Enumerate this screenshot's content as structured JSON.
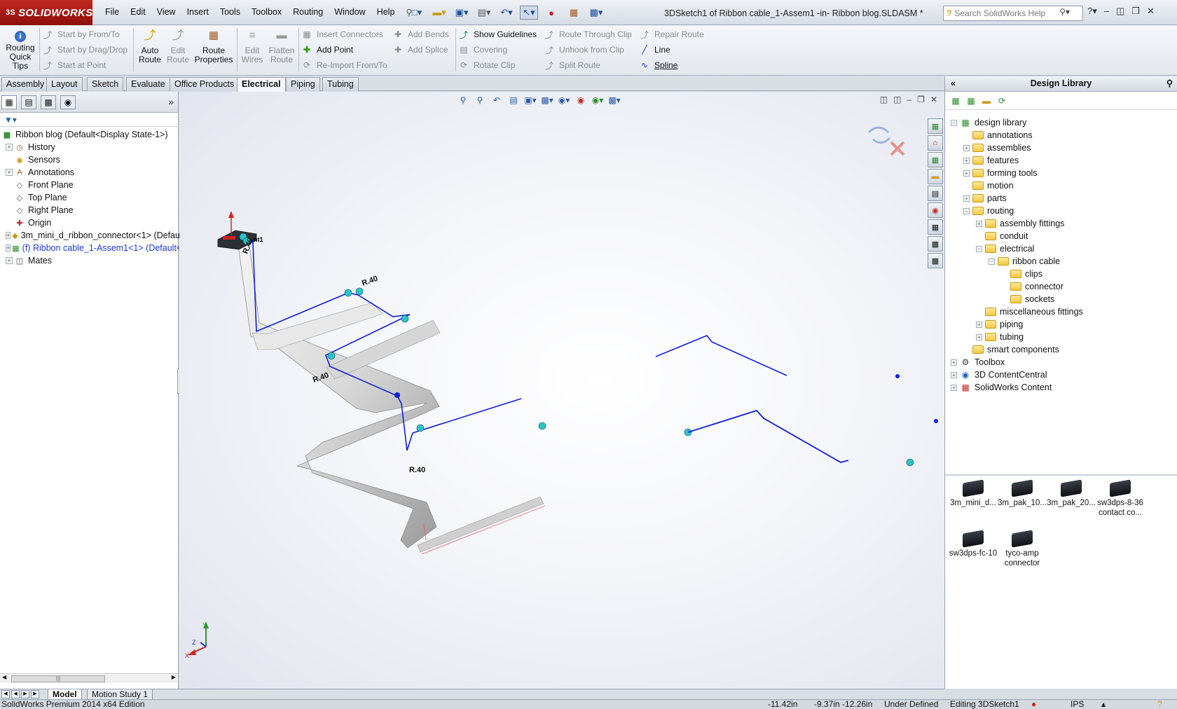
{
  "app": {
    "logo_text": "SOLIDWORKS",
    "logo_prefix": "3S",
    "window_title": "3DSketch1 of Ribbon cable_1-Assem1 -in- Ribbon blog.SLDASM *",
    "search_placeholder": "Search SolidWorks Help"
  },
  "menu": [
    "File",
    "Edit",
    "View",
    "Insert",
    "Tools",
    "Toolbox",
    "Routing",
    "Window",
    "Help"
  ],
  "ribbon": {
    "routing_quick_tips": "Routing Quick Tips",
    "start_from_to": "Start by From/To",
    "start_drag_drop": "Start by Drag/Drop",
    "start_at_point": "Start at Point",
    "auto_route": "Auto Route",
    "edit_route": "Edit Route",
    "route_properties": "Route Properties",
    "edit_wires": "Edit Wires",
    "flatten_route": "Flatten Route",
    "insert_connectors": "Insert Connectors",
    "add_point": "Add Point",
    "reimport_from_to": "Re-Import From/To",
    "add_bends": "Add Bends",
    "add_splice": "Add Splice",
    "show_guidelines": "Show Guidelines",
    "covering": "Covering",
    "rotate_clip": "Rotate Clip",
    "route_through_clip": "Route Through Clip",
    "unhook_from_clip": "Unhook from Clip",
    "split_route": "Split Route",
    "repair_route": "Repair Route",
    "line": "Line",
    "spline": "Spline"
  },
  "cm_tabs": [
    "Assembly",
    "Layout",
    "Sketch",
    "Evaluate",
    "Office Products",
    "Electrical",
    "Piping",
    "Tubing"
  ],
  "cm_active": "Electrical",
  "feature_tree": {
    "root": "Ribbon blog  (Default<Display State-1>)",
    "items": [
      {
        "label": "History",
        "icon": "history-icon",
        "expand": true
      },
      {
        "label": "Sensors",
        "icon": "sensors-icon",
        "expand": false
      },
      {
        "label": "Annotations",
        "icon": "annotations-icon",
        "expand": true
      },
      {
        "label": "Front Plane",
        "icon": "plane-icon",
        "expand": false
      },
      {
        "label": "Top Plane",
        "icon": "plane-icon",
        "expand": false
      },
      {
        "label": "Right Plane",
        "icon": "plane-icon",
        "expand": false
      },
      {
        "label": "Origin",
        "icon": "origin-icon",
        "expand": false
      },
      {
        "label": "3m_mini_d_ribbon_connector<1> (Defau",
        "icon": "part-icon",
        "expand": true
      },
      {
        "label": "(f) Ribbon cable_1-Assem1<1> (Default<",
        "icon": "assembly-icon",
        "expand": true,
        "active": true
      },
      {
        "label": "Mates",
        "icon": "mates-icon",
        "expand": true
      }
    ]
  },
  "graphics": {
    "dim_labels": [
      "R.40",
      "R.40",
      "R.40",
      "R.40"
    ],
    "point_label": "nt1",
    "triad": {
      "x": "X",
      "y": "Y",
      "z": "Z"
    }
  },
  "design_library": {
    "title": "Design Library",
    "tree": [
      {
        "label": "design library",
        "level": 0,
        "expand": "minus",
        "kind": "root"
      },
      {
        "label": "annotations",
        "level": 1,
        "expand": "none",
        "kind": "folder"
      },
      {
        "label": "assemblies",
        "level": 1,
        "expand": "plus",
        "kind": "folder"
      },
      {
        "label": "features",
        "level": 1,
        "expand": "plus",
        "kind": "folder"
      },
      {
        "label": "forming tools",
        "level": 1,
        "expand": "plus",
        "kind": "folder"
      },
      {
        "label": "motion",
        "level": 1,
        "expand": "none",
        "kind": "folder"
      },
      {
        "label": "parts",
        "level": 1,
        "expand": "plus",
        "kind": "folder"
      },
      {
        "label": "routing",
        "level": 1,
        "expand": "minus",
        "kind": "folder"
      },
      {
        "label": "assembly fittings",
        "level": 2,
        "expand": "plus",
        "kind": "folder"
      },
      {
        "label": "conduit",
        "level": 2,
        "expand": "none",
        "kind": "folder"
      },
      {
        "label": "electrical",
        "level": 2,
        "expand": "minus",
        "kind": "folder"
      },
      {
        "label": "ribbon cable",
        "level": 3,
        "expand": "minus",
        "kind": "folder"
      },
      {
        "label": "clips",
        "level": 4,
        "expand": "none",
        "kind": "folder"
      },
      {
        "label": "connector",
        "level": 4,
        "expand": "none",
        "kind": "folder"
      },
      {
        "label": "sockets",
        "level": 4,
        "expand": "none",
        "kind": "folder"
      },
      {
        "label": "miscellaneous fittings",
        "level": 2,
        "expand": "none",
        "kind": "folder"
      },
      {
        "label": "piping",
        "level": 2,
        "expand": "plus",
        "kind": "folder"
      },
      {
        "label": "tubing",
        "level": 2,
        "expand": "plus",
        "kind": "folder"
      },
      {
        "label": "smart components",
        "level": 1,
        "expand": "none",
        "kind": "folder"
      },
      {
        "label": "Toolbox",
        "level": 0,
        "expand": "plus",
        "kind": "toolbox"
      },
      {
        "label": "3D ContentCentral",
        "level": 0,
        "expand": "plus",
        "kind": "globe"
      },
      {
        "label": "SolidWorks Content",
        "level": 0,
        "expand": "plus",
        "kind": "swcontent"
      }
    ],
    "items": [
      {
        "line1": "3m_mini_d...",
        "line2": ""
      },
      {
        "line1": "3m_pak_10...",
        "line2": ""
      },
      {
        "line1": "3m_pak_20...",
        "line2": ""
      },
      {
        "line1": "sw3dps-8-36",
        "line2": "contact co..."
      },
      {
        "line1": "sw3dps-fc-10",
        "line2": ""
      },
      {
        "line1": "tyco-amp",
        "line2": "connector"
      }
    ]
  },
  "bottom_tabs": {
    "model": "Model",
    "motion": "Motion Study 1"
  },
  "status": {
    "edition": "SolidWorks Premium 2014 x64 Edition",
    "x": "-11.42in",
    "yz": "-9.37in -12.26in",
    "state": "Under Defined",
    "editing": "Editing 3DSketch1",
    "units": "IPS"
  },
  "colors": {
    "accent": "#1a3ad6",
    "sketch_line": "#1020e0",
    "endpoint": "#20b8b8",
    "logo_red": "#b0201a"
  }
}
